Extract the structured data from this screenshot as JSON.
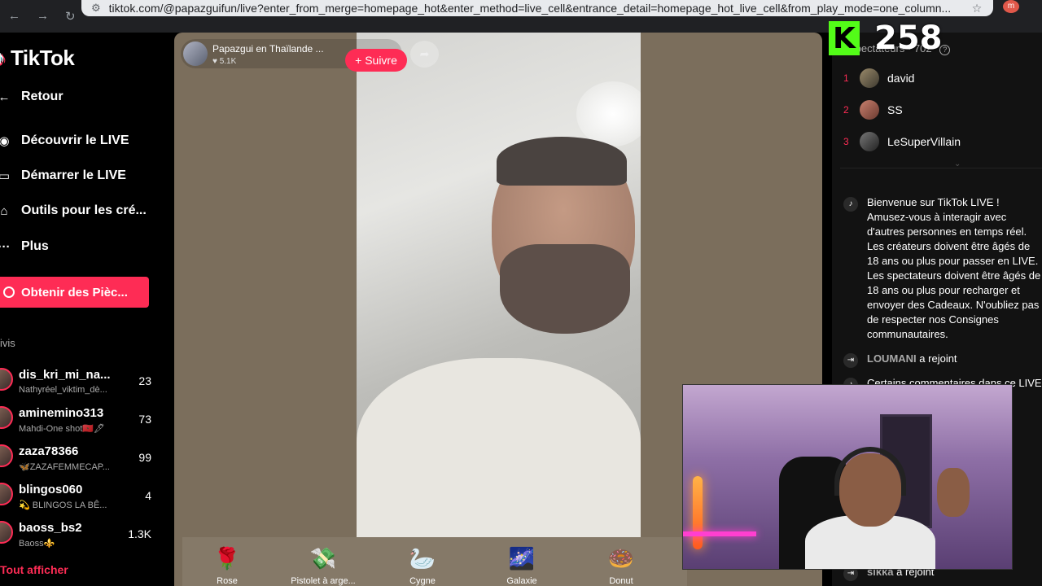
{
  "browser": {
    "url": "tiktok.com/@papazguifun/live?enter_from_merge=homepage_hot&enter_method=live_cell&entrance_detail=homepage_hot_live_cell&from_play_mode=one_column...",
    "profile_initial": "m"
  },
  "sidebar": {
    "logo": "TikTok",
    "menu": [
      {
        "label": "Retour",
        "icon": "arrow-left-icon"
      },
      {
        "label": "Découvrir le LIVE",
        "icon": "live-icon"
      },
      {
        "label": "Démarrer le LIVE",
        "icon": "video-camera-icon"
      },
      {
        "label": "Outils pour les cré...",
        "icon": "home-tools-icon"
      },
      {
        "label": "Plus",
        "icon": "more-icon"
      }
    ],
    "coins_button": "Obtenir des Pièc...",
    "following_heading": "ivis",
    "following": [
      {
        "name": "dis_kri_mi_na...",
        "sub": "Nathyréel_viktim_dè...",
        "count": "23"
      },
      {
        "name": "aminemino313",
        "sub": "Mahdi-One shot🇲🇦🖋",
        "count": "73"
      },
      {
        "name": "zaza78366",
        "sub": "🦋ZAZAFEMMECAP...",
        "count": "99"
      },
      {
        "name": "blingos060",
        "sub": "💫 BLINGOS LA BÊ...",
        "count": "4"
      },
      {
        "name": "baoss_bs2",
        "sub": "Baoss⚜️",
        "count": "1.3K"
      }
    ],
    "see_all": "Tout afficher"
  },
  "stage": {
    "host_name": "Papazgui en Thaïlande ...",
    "host_likes": "♥ 5.1K",
    "follow_button": "+ Suivre",
    "gifts": [
      {
        "label": "Rose",
        "icon": "rose-icon",
        "glyph": "🌹"
      },
      {
        "label": "Pistolet à arge...",
        "icon": "money-gun-icon",
        "glyph": "💸"
      },
      {
        "label": "Cygne",
        "icon": "swan-icon",
        "glyph": "🦢"
      },
      {
        "label": "Galaxie",
        "icon": "galaxy-icon",
        "glyph": "🌌"
      },
      {
        "label": "Donut",
        "icon": "donut-icon",
        "glyph": "🍩"
      }
    ]
  },
  "panel": {
    "viewers_heading": "Spectateurs · 702",
    "viewers": [
      {
        "rank": "1",
        "name": "david"
      },
      {
        "rank": "2",
        "name": "SS"
      },
      {
        "rank": "3",
        "name": "LeSuperVillain"
      }
    ],
    "chat": [
      {
        "type": "system",
        "text": "Bienvenue sur TikTok LIVE ! Amusez-vous à interagir avec d'autres personnes en temps réel. Les créateurs doivent être âgés de 18 ans ou plus pour passer en LIVE. Les spectateurs doivent être âgés de 18 ans ou plus pour recharger et envoyer des Cadeaux. N'oubliez pas de respecter nos Consignes communautaires."
      },
      {
        "type": "join",
        "user": "LOUMANI",
        "text": "a rejoint"
      },
      {
        "type": "system",
        "text": "Certains commentaires dans ce LIVE"
      },
      {
        "type": "join",
        "user": "sikka",
        "text": "a rejoint"
      }
    ]
  },
  "overlay": {
    "counter_value": "258",
    "counter_logo": "K",
    "counter_color": "#53fc18"
  },
  "colors": {
    "accent": "#fe2c55",
    "stage_bg": "#7b6e5c"
  }
}
